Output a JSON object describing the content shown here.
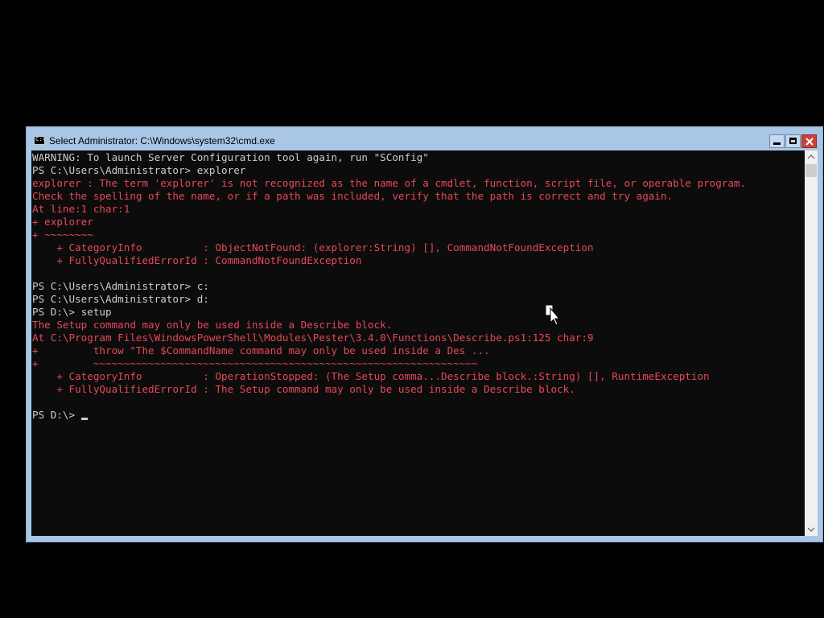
{
  "window": {
    "title": "Select Administrator: C:\\Windows\\system32\\cmd.exe",
    "icon_label": "C:\\"
  },
  "console": {
    "lines": [
      {
        "text": "WARNING: To launch Server Configuration tool again, run \"SConfig\"",
        "color": "white"
      },
      {
        "text": "PS C:\\Users\\Administrator> explorer",
        "color": "white"
      },
      {
        "text": "explorer : The term 'explorer' is not recognized as the name of a cmdlet, function, script file, or operable program.",
        "color": "red"
      },
      {
        "text": "Check the spelling of the name, or if a path was included, verify that the path is correct and try again.",
        "color": "red"
      },
      {
        "text": "At line:1 char:1",
        "color": "red"
      },
      {
        "text": "+ explorer",
        "color": "red"
      },
      {
        "text": "+ ~~~~~~~~",
        "color": "red"
      },
      {
        "text": "    + CategoryInfo          : ObjectNotFound: (explorer:String) [], CommandNotFoundException",
        "color": "red"
      },
      {
        "text": "    + FullyQualifiedErrorId : CommandNotFoundException",
        "color": "red"
      },
      {
        "text": "",
        "color": "white"
      },
      {
        "text": "PS C:\\Users\\Administrator> c:",
        "color": "white"
      },
      {
        "text": "PS C:\\Users\\Administrator> d:",
        "color": "white"
      },
      {
        "text": "PS D:\\> setup",
        "color": "white"
      },
      {
        "text": "The Setup command may only be used inside a Describe block.",
        "color": "red"
      },
      {
        "text": "At C:\\Program Files\\WindowsPowerShell\\Modules\\Pester\\3.4.0\\Functions\\Describe.ps1:125 char:9",
        "color": "red"
      },
      {
        "text": "+         throw \"The $CommandName command may only be used inside a Des ...",
        "color": "red"
      },
      {
        "text": "+         ~~~~~~~~~~~~~~~~~~~~~~~~~~~~~~~~~~~~~~~~~~~~~~~~~~~~~~~~~~~~~~~",
        "color": "red"
      },
      {
        "text": "    + CategoryInfo          : OperationStopped: (The Setup comma...Describe block.:String) [], RuntimeException",
        "color": "red"
      },
      {
        "text": "    + FullyQualifiedErrorId : The Setup command may only be used inside a Describe block.",
        "color": "red"
      },
      {
        "text": "",
        "color": "white"
      },
      {
        "text": "PS D:\\> ",
        "color": "white",
        "cursor": true
      }
    ]
  },
  "colors": {
    "console_bg": "#0c0c0c",
    "text_white": "#cccccc",
    "text_red": "#e74856",
    "titlebar": "#a9c6e6"
  },
  "icons": {
    "minimize": "minimize-icon",
    "maximize": "maximize-icon",
    "close": "close-icon",
    "scroll_up": "chevron-up-icon",
    "scroll_down": "chevron-down-icon",
    "pointer": "mouse-pointer-icon"
  }
}
